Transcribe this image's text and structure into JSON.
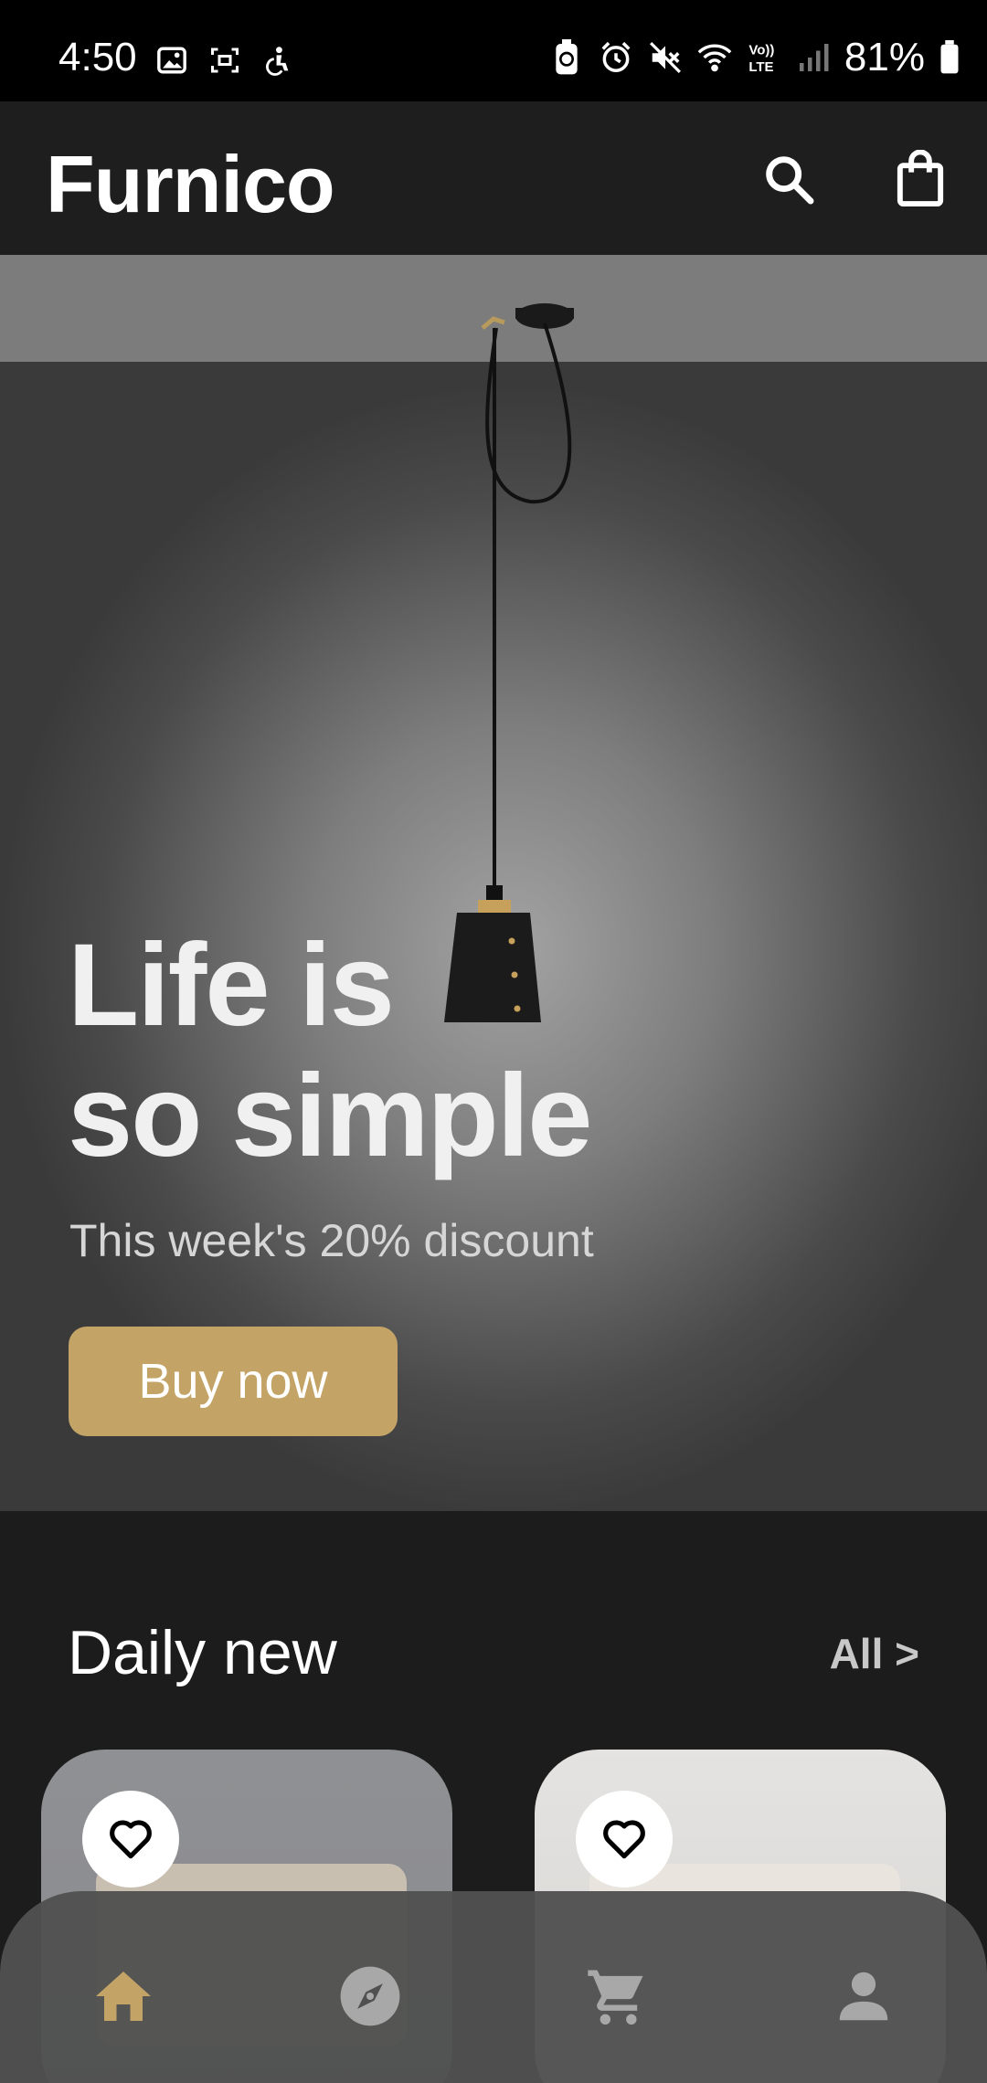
{
  "status_bar": {
    "time": "4:50",
    "battery": "81%",
    "left_icons": [
      "image-icon",
      "screenshot-icon",
      "accessibility-icon"
    ],
    "right_icons": [
      "battery-saver-icon",
      "alarm-icon",
      "mute-icon",
      "wifi-icon",
      "volte-icon",
      "signal-icon",
      "battery-icon"
    ]
  },
  "app_bar": {
    "title": "Furnico",
    "icons": [
      "search-icon",
      "shopping-bag-icon"
    ]
  },
  "hero": {
    "title_line1": "Life is",
    "title_line2": "so simple",
    "subtitle": "This week's 20% discount",
    "cta_label": "Buy now"
  },
  "daily_new": {
    "title": "Daily new",
    "all_link": "All >",
    "products": [
      {
        "favorite_icon": "heart-outline-icon"
      },
      {
        "favorite_icon": "heart-outline-icon"
      }
    ]
  },
  "bottom_nav": {
    "items": [
      {
        "name": "home",
        "icon": "home-icon",
        "active": true
      },
      {
        "name": "explore",
        "icon": "compass-icon",
        "active": false
      },
      {
        "name": "cart",
        "icon": "cart-icon",
        "active": false
      },
      {
        "name": "profile",
        "icon": "person-icon",
        "active": false
      }
    ]
  },
  "colors": {
    "accent": "#c4a466",
    "background": "#1c1c1c",
    "nav_inactive": "#a8a8a8"
  }
}
